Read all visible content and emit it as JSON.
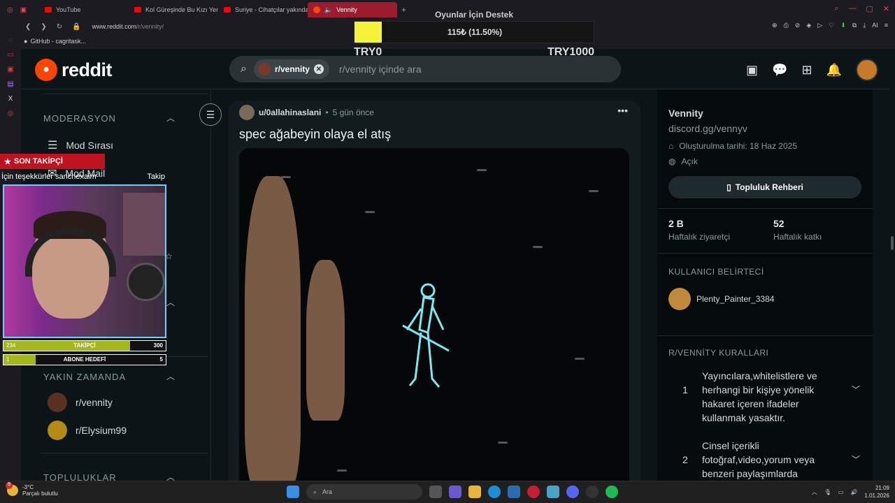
{
  "browser": {
    "tabs": [
      {
        "label": "YouTube",
        "active": false
      },
      {
        "label": "Kol Güreşinde Bu Kızı Yen",
        "active": false
      },
      {
        "label": "Suriye - Cihatçılar yakında",
        "active": false
      },
      {
        "label": "Vennity",
        "active": true
      }
    ],
    "url_host": "www.reddit.com",
    "url_path": "/r/vennity/",
    "bookmark": "GitHub - cagritask..."
  },
  "donation": {
    "title": "Oyunlar İçin Destek",
    "current": "115₺ (11.50%)",
    "progress_fraction": 0.115,
    "min": "TRY0",
    "max": "TRY1000",
    "fill_color": "#f4f33a"
  },
  "reddit": {
    "logo": "reddit",
    "search_chip": "r/vennity",
    "search_placeholder": "r/vennity içinde ara",
    "header_icons": [
      "advertise-icon",
      "chat-icon",
      "create-icon",
      "notifications-icon",
      "user-avatar"
    ]
  },
  "left_sidebar": {
    "moderation": {
      "heading": "MODERASYON",
      "items": [
        "Mod Sırası",
        "Mod Mail"
      ]
    },
    "recent": {
      "heading": "YAKIN ZAMANDA",
      "items": [
        "r/vennity",
        "r/Elysium99"
      ]
    },
    "communities": {
      "heading": "TOPLULUKLAR"
    }
  },
  "stream_overlay": {
    "follow_title": "SON TAKİPÇİ",
    "follow_message": "İçin teşekkürler sanchexaim",
    "follow_right": "Takip",
    "followers": {
      "current": "234",
      "label": "TAKİPÇİ",
      "goal": "300",
      "fraction": 0.78
    },
    "subs": {
      "current": "1",
      "label": "ABONE HEDEFİ",
      "goal": "5",
      "fraction": 0.2
    }
  },
  "post": {
    "author": "u/0allahinaslani",
    "time": "5 gün önce",
    "title": "spec ağabeyin olaya el atış"
  },
  "right_sidebar": {
    "community_name": "Vennity",
    "link": "discord.gg/vennyv",
    "created": "Oluşturulma tarihi: 18 Haz 2025",
    "visibility": "Açık",
    "guide_button": "Topluluk Rehberi",
    "stats": [
      {
        "value": "2 B",
        "label": "Haftalık ziyaretçi"
      },
      {
        "value": "52",
        "label": "Haftalık katkı"
      }
    ],
    "user_flair_heading": "KULLANICI BELİRTECİ",
    "user_flair_name": "Plenty_Painter_3384",
    "rules_heading": "R/VENNİTY KURALLARI",
    "rules": [
      {
        "num": "1",
        "text": "Yayıncılara,whitelistlere ve herhangi bir kişiye yönelik hakaret içeren ifadeler kullanmak yasaktır."
      },
      {
        "num": "2",
        "text": "Cinsel içerikli fotoğraf,video,yorum veya benzeri paylaşımlarda"
      }
    ]
  },
  "taskbar": {
    "weather_temp": "-3°C",
    "weather_desc": "Parçalı bulutlu",
    "weather_badge": "9",
    "search": "Ara",
    "time": "21:09",
    "date": "1.01.2026"
  }
}
